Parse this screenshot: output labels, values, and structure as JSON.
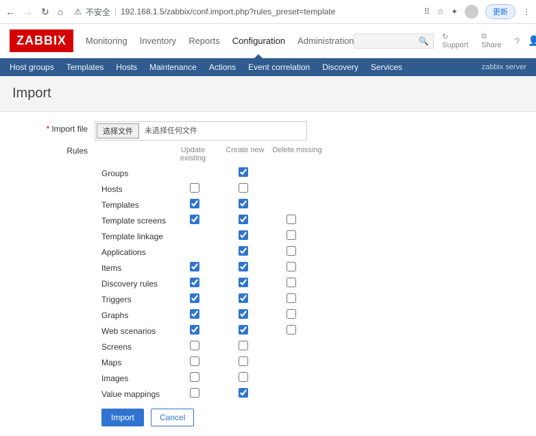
{
  "browser": {
    "insecure_label": "不安全",
    "url": "192.168.1.5/zabbix/conf.import.php?rules_preset=template",
    "update_label": "更新"
  },
  "header": {
    "logo": "ZABBIX",
    "nav": [
      "Monitoring",
      "Inventory",
      "Reports",
      "Configuration",
      "Administration"
    ],
    "active_index": 3,
    "support": "Support",
    "share": "Share"
  },
  "subnav": {
    "items": [
      "Host groups",
      "Templates",
      "Hosts",
      "Maintenance",
      "Actions",
      "Event correlation",
      "Discovery",
      "Services"
    ],
    "server_label": "zabbix server"
  },
  "page": {
    "title": "Import",
    "import_file_label": "Import file",
    "choose_file_btn": "选择文件",
    "no_file_text": "未选择任何文件",
    "rules_label": "Rules",
    "col_update": "Update existing",
    "col_create": "Create new",
    "col_delete": "Delete missing",
    "rules": [
      {
        "name": "Groups",
        "update": null,
        "create": true,
        "delete": null
      },
      {
        "name": "Hosts",
        "update": false,
        "create": false,
        "delete": null
      },
      {
        "name": "Templates",
        "update": true,
        "create": true,
        "delete": null
      },
      {
        "name": "Template screens",
        "update": true,
        "create": true,
        "delete": false
      },
      {
        "name": "Template linkage",
        "update": null,
        "create": true,
        "delete": false
      },
      {
        "name": "Applications",
        "update": null,
        "create": true,
        "delete": false
      },
      {
        "name": "Items",
        "update": true,
        "create": true,
        "delete": false
      },
      {
        "name": "Discovery rules",
        "update": true,
        "create": true,
        "delete": false
      },
      {
        "name": "Triggers",
        "update": true,
        "create": true,
        "delete": false
      },
      {
        "name": "Graphs",
        "update": true,
        "create": true,
        "delete": false
      },
      {
        "name": "Web scenarios",
        "update": true,
        "create": true,
        "delete": false
      },
      {
        "name": "Screens",
        "update": false,
        "create": false,
        "delete": null
      },
      {
        "name": "Maps",
        "update": false,
        "create": false,
        "delete": null
      },
      {
        "name": "Images",
        "update": false,
        "create": false,
        "delete": null
      },
      {
        "name": "Value mappings",
        "update": false,
        "create": true,
        "delete": null
      }
    ],
    "import_btn": "Import",
    "cancel_btn": "Cancel"
  }
}
